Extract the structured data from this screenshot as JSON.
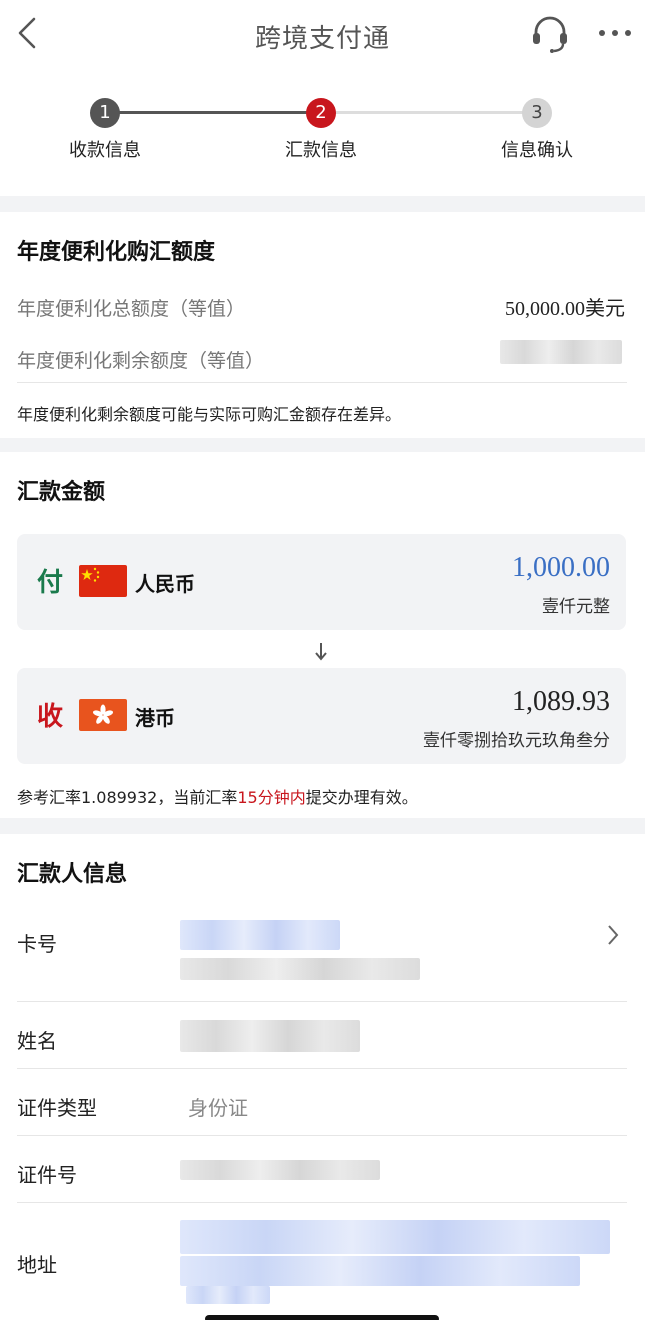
{
  "header": {
    "title": "跨境支付通",
    "icons": {
      "back": "back-icon",
      "service": "headset-icon",
      "more": "more-icon"
    }
  },
  "steps": [
    {
      "num": "1",
      "label": "收款信息",
      "state": "done"
    },
    {
      "num": "2",
      "label": "汇款信息",
      "state": "current"
    },
    {
      "num": "3",
      "label": "信息确认",
      "state": "todo"
    }
  ],
  "quota": {
    "title": "年度便利化购汇额度",
    "total_label": "年度便利化总额度（等值）",
    "total_value": "50,000.00美元",
    "remaining_label": "年度便利化剩余额度（等值）",
    "note": "年度便利化剩余额度可能与实际可购汇金额存在差异。"
  },
  "amount": {
    "title": "汇款金额",
    "pay": {
      "tag": "付",
      "currency": "人民币",
      "value": "1,000.00",
      "words": "壹仟元整"
    },
    "receive": {
      "tag": "收",
      "currency": "港币",
      "value": "1,089.93",
      "words": "壹仟零捌拾玖元玖角叁分"
    },
    "rate_prefix": "参考汇率1.089932，当前汇率",
    "rate_highlight": "15分钟内",
    "rate_suffix": "提交办理有效。"
  },
  "remitter": {
    "title": "汇款人信息",
    "card_label": "卡号",
    "name_label": "姓名",
    "id_type_label": "证件类型",
    "id_type_value": "身份证",
    "id_no_label": "证件号",
    "address_label": "地址"
  },
  "colors": {
    "accent_red": "#c8161d",
    "pay_green": "#1a7a4c",
    "pay_amount_blue": "#3a6fc4",
    "step_done": "#555555",
    "step_todo": "#cccccc"
  }
}
